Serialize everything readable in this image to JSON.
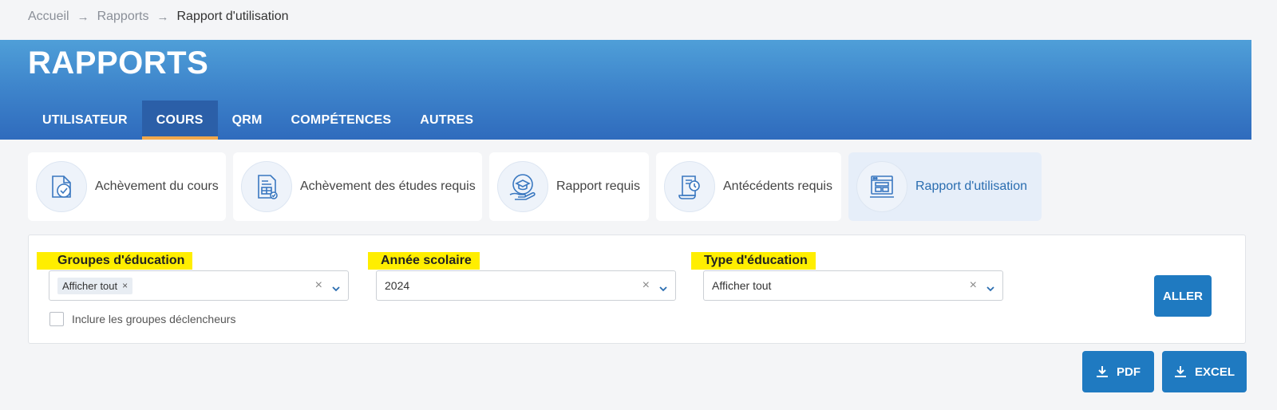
{
  "breadcrumb": {
    "items": [
      "Accueil",
      "Rapports",
      "Rapport d'utilisation"
    ]
  },
  "header": {
    "title": "RAPPORTS",
    "tabs": [
      {
        "label": "UTILISATEUR",
        "active": false
      },
      {
        "label": "COURS",
        "active": true
      },
      {
        "label": "QRM",
        "active": false
      },
      {
        "label": "COMPÉTENCES",
        "active": false
      },
      {
        "label": "AUTRES",
        "active": false
      }
    ]
  },
  "report_cards": [
    {
      "label": "Achèvement du cours",
      "icon": "clipboard-check-icon",
      "active": false
    },
    {
      "label": "Achèvement des études requis",
      "icon": "document-check-icon",
      "active": false
    },
    {
      "label": "Rapport requis",
      "icon": "hand-graduation-cap-icon",
      "active": false
    },
    {
      "label": "Antécédents requis",
      "icon": "scroll-clock-icon",
      "active": false
    },
    {
      "label": "Rapport d'utilisation",
      "icon": "browser-window-icon",
      "active": true
    }
  ],
  "filters": {
    "education_groups": {
      "label": "Groupes d'éducation",
      "chip": "Afficher tout",
      "chip_remove": "×"
    },
    "school_year": {
      "label": "Année scolaire",
      "value": "2024"
    },
    "education_type": {
      "label": "Type d'éducation",
      "value": "Afficher tout"
    },
    "clear_symbol": "×",
    "include_trigger_groups": {
      "label": "Inclure les groupes déclencheurs",
      "checked": false
    },
    "go_label": "ALLER"
  },
  "export": {
    "pdf_label": "PDF",
    "excel_label": "EXCEL"
  },
  "colors": {
    "primary": "#1f7ac1",
    "header_top": "#4f9fd8",
    "header_bottom": "#2f6bbd",
    "active_tab_underline": "#f2a84b",
    "label_highlight": "#ffee00"
  }
}
